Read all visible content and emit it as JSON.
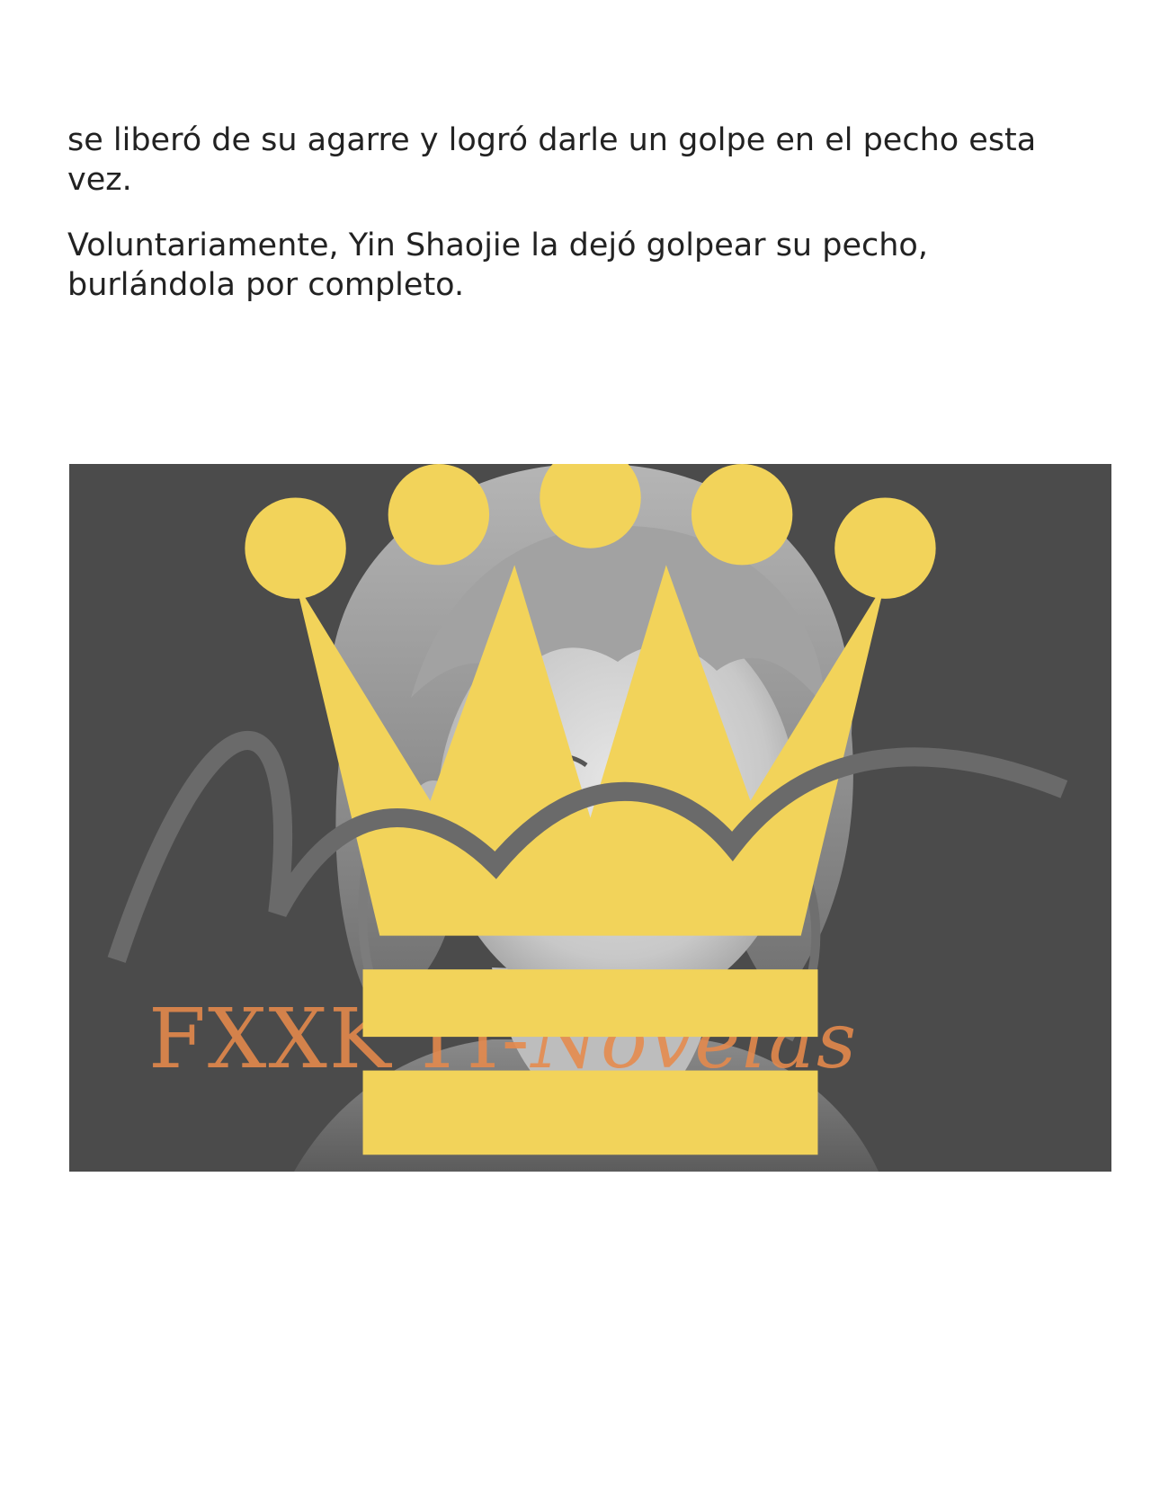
{
  "document": {
    "paragraphs": [
      "se liberó de su agarre y logró darle un golpe en el pecho esta vez.",
      "Voluntariamente, Yin Shaojie la dejó golpear su pecho, burlándola por completo."
    ]
  },
  "image": {
    "watermark_text": "FXXK IT-",
    "watermark_italic": "Novelas",
    "watermark_color": "#e78a4c",
    "crown_color": "#f2d35a",
    "background_color": "#4a4a4a",
    "crown_icon": "crown-icon"
  }
}
